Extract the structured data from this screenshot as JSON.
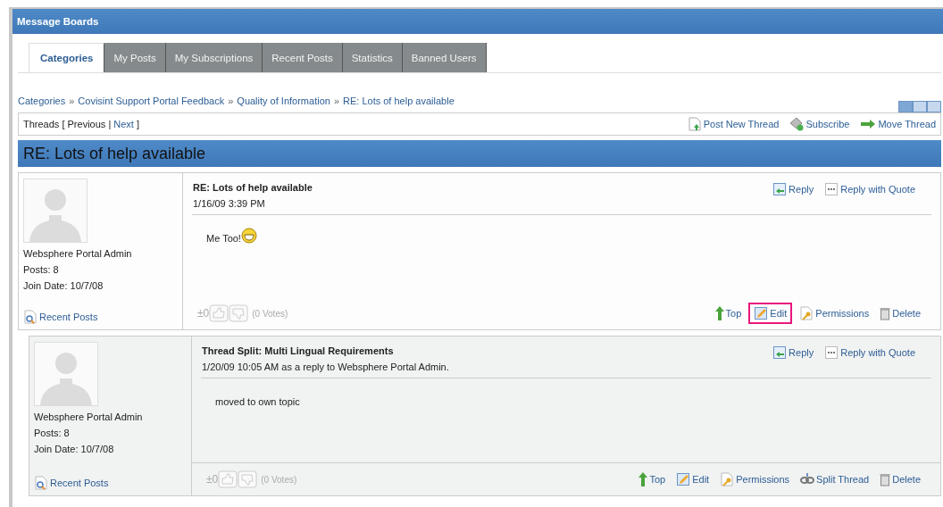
{
  "portlet": {
    "title": "Message Boards"
  },
  "tabs": [
    {
      "label": "Categories",
      "selected": true
    },
    {
      "label": "My Posts",
      "selected": false
    },
    {
      "label": "My Subscriptions",
      "selected": false
    },
    {
      "label": "Recent Posts",
      "selected": false
    },
    {
      "label": "Statistics",
      "selected": false
    },
    {
      "label": "Banned Users",
      "selected": false
    }
  ],
  "breadcrumb": [
    "Categories",
    "Covisint Support Portal Feedback",
    "Quality of Information",
    "RE: Lots of help available"
  ],
  "breadcrumb_separator": "»",
  "view_modes": [
    {
      "selected": true
    },
    {
      "selected": false
    },
    {
      "selected": false
    }
  ],
  "thread_nav": {
    "label": "Threads [",
    "previous": "Previous",
    "separator": "|",
    "next": "Next",
    "close": "]"
  },
  "thread_actions": [
    {
      "kind": "post",
      "label": "Post New Thread"
    },
    {
      "kind": "subscribe",
      "label": "Subscribe"
    },
    {
      "kind": "move",
      "label": "Move Thread"
    }
  ],
  "thread_title": "RE: Lots of help available",
  "posts": [
    {
      "kind": "root",
      "author": "Websphere Portal Admin",
      "posts": "Posts: 8",
      "join_date": "Join Date: 10/7/08",
      "recent_posts": "Recent Posts",
      "title": "RE: Lots of help available",
      "date": "1/16/09 3:39 PM",
      "body": "Me Too!",
      "emoticon": true,
      "score": "±0",
      "votes": "(0 Votes)",
      "top_actions": [
        {
          "kind": "reply",
          "label": "Reply"
        },
        {
          "kind": "quote",
          "label": "Reply with Quote"
        }
      ],
      "actions": [
        {
          "kind": "top",
          "label": "Top",
          "highlighted": false
        },
        {
          "kind": "edit",
          "label": "Edit",
          "highlighted": true
        },
        {
          "kind": "permissions",
          "label": "Permissions",
          "highlighted": false
        },
        {
          "kind": "delete",
          "label": "Delete",
          "highlighted": false
        }
      ]
    },
    {
      "kind": "reply",
      "author": "Websphere Portal Admin",
      "posts": "Posts: 8",
      "join_date": "Join Date: 10/7/08",
      "recent_posts": "Recent Posts",
      "title": "Thread Split: Multi Lingual Requirements",
      "date": "1/20/09 10:05 AM as a reply to Websphere Portal Admin.",
      "body": "moved to own topic",
      "emoticon": false,
      "score": "±0",
      "votes": "(0 Votes)",
      "top_actions": [
        {
          "kind": "reply",
          "label": "Reply"
        },
        {
          "kind": "quote",
          "label": "Reply with Quote"
        }
      ],
      "actions": [
        {
          "kind": "top",
          "label": "Top",
          "highlighted": false
        },
        {
          "kind": "edit",
          "label": "Edit",
          "highlighted": false
        },
        {
          "kind": "permissions",
          "label": "Permissions",
          "highlighted": false
        },
        {
          "kind": "split",
          "label": "Split Thread",
          "highlighted": false
        },
        {
          "kind": "delete",
          "label": "Delete",
          "highlighted": false
        }
      ]
    }
  ]
}
